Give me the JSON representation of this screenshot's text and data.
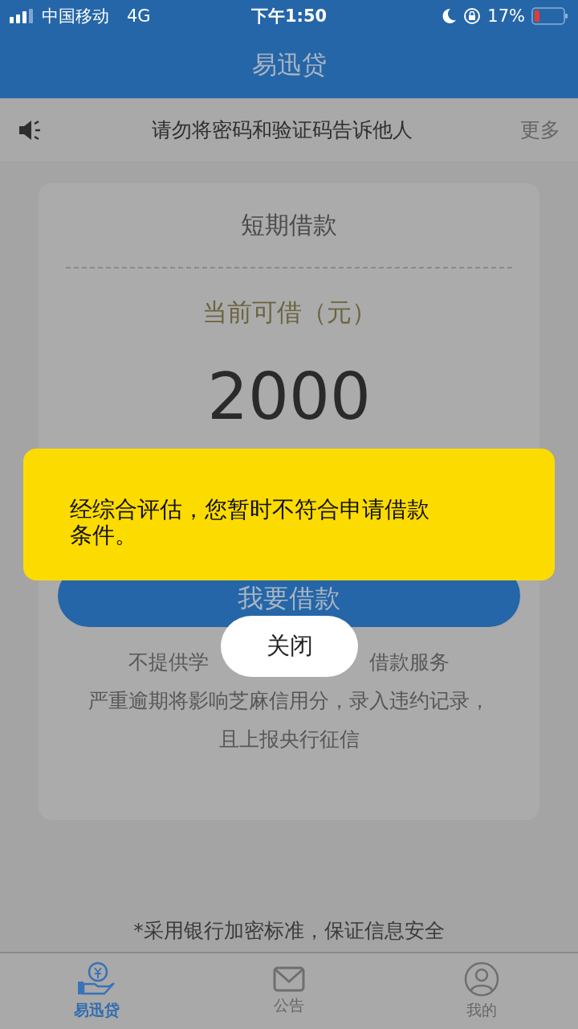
{
  "status_bar": {
    "carrier": "中国移动",
    "network": "4G",
    "time": "下午1:50",
    "battery": "17%"
  },
  "header": {
    "title": "易迅贷"
  },
  "notice": {
    "text": "请勿将密码和验证码告诉他人",
    "more": "更多"
  },
  "card": {
    "title": "短期借款",
    "amount_label": "当前可借（元）",
    "amount": "2000",
    "button": "我要借款",
    "notes_partial": [
      "不提供学",
      "借款服务"
    ],
    "notes": [
      "严重逾期将影响芝麻信用分，录入违约记录，",
      "且上报央行征信"
    ]
  },
  "footer_note": "*采用银行加密标准，保证信息安全",
  "tabs": [
    {
      "label": "易迅贷",
      "kind": "loan",
      "selected": true
    },
    {
      "label": "公告",
      "kind": "mail",
      "selected": false
    },
    {
      "label": "我的",
      "kind": "profile",
      "selected": false
    }
  ],
  "dialog": {
    "message": "经综合评估，您暂时不符合申请借款条件。",
    "close": "关闭"
  }
}
